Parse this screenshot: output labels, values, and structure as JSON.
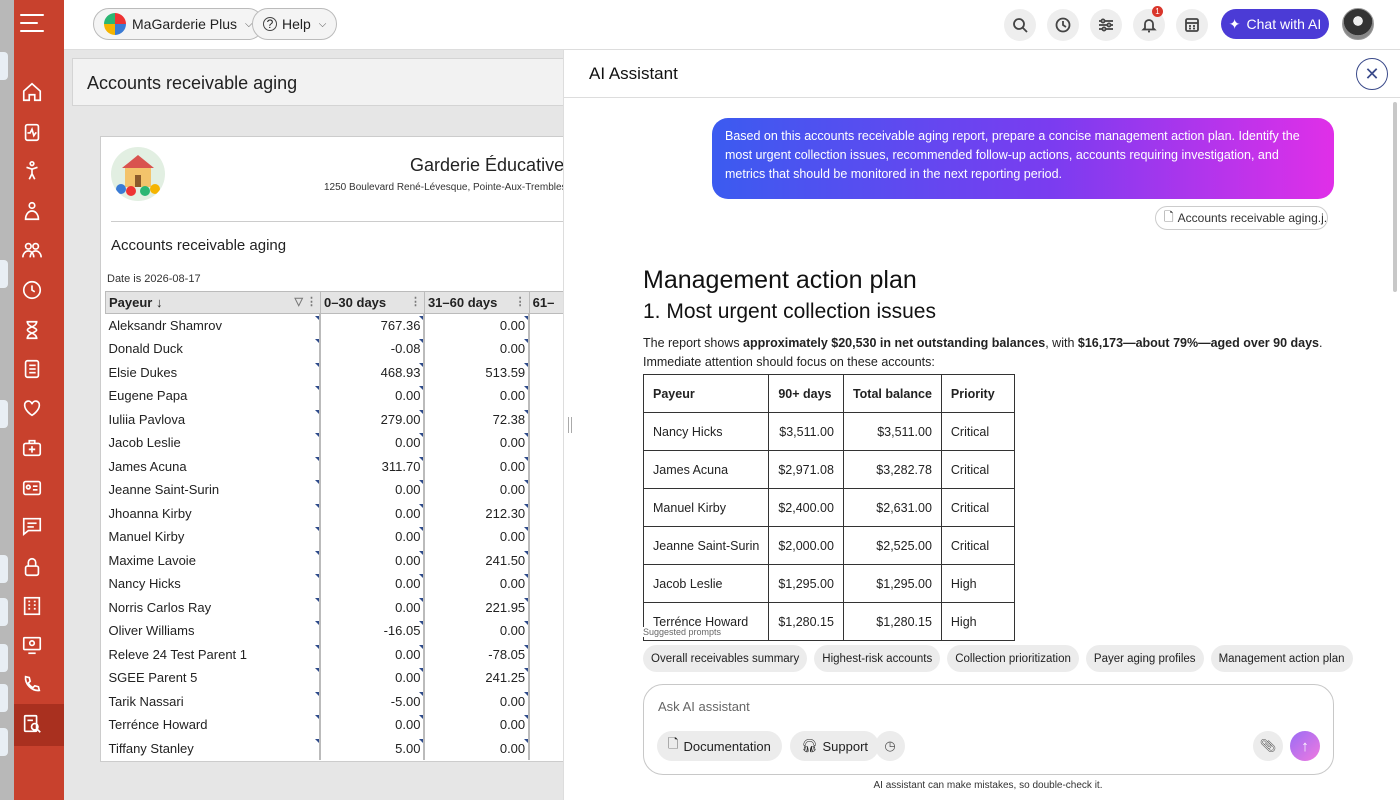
{
  "topbar": {
    "org_selector": "MaGarderie Plus",
    "help": "Help",
    "notifications_count": "1",
    "chat_button": "Chat with AI",
    "icons": [
      "search-icon",
      "history-icon",
      "sliders-icon",
      "bell-icon",
      "calculator-icon"
    ]
  },
  "sidebar": {
    "icons": [
      "home-icon",
      "clipboard-pulse-icon",
      "child-icon",
      "educator-icon",
      "group-icon",
      "clock-icon",
      "hourglass-icon",
      "checklist-icon",
      "heart-icon",
      "first-aid-icon",
      "id-card-icon",
      "message-icon",
      "lock-icon",
      "building-icon",
      "presentation-icon",
      "phone-icon",
      "report-search-icon"
    ]
  },
  "report": {
    "title": "Accounts receivable aging",
    "school_name": "Garderie Éducative",
    "school_address": "1250 Boulevard René-Lévesque, Pointe-Aux-Trembles,",
    "subtitle": "Accounts receivable aging",
    "date": "Date is 2026-08-17",
    "columns": [
      "Payeur ↓",
      "0–30 days",
      "31–60 days",
      "61–"
    ],
    "rows": [
      [
        "Aleksandr Shamrov",
        "767.36",
        "0.00"
      ],
      [
        "Donald Duck",
        "-0.08",
        "0.00"
      ],
      [
        "Elsie Dukes",
        "468.93",
        "513.59"
      ],
      [
        "Eugene Papa",
        "0.00",
        "0.00"
      ],
      [
        "Iuliia Pavlova",
        "279.00",
        "72.38"
      ],
      [
        "Jacob Leslie",
        "0.00",
        "0.00"
      ],
      [
        "James Acuna",
        "311.70",
        "0.00"
      ],
      [
        "Jeanne Saint-Surin",
        "0.00",
        "0.00"
      ],
      [
        "Jhoanna Kirby",
        "0.00",
        "212.30"
      ],
      [
        "Manuel Kirby",
        "0.00",
        "0.00"
      ],
      [
        "Maxime Lavoie",
        "0.00",
        "241.50"
      ],
      [
        "Nancy Hicks",
        "0.00",
        "0.00"
      ],
      [
        "Norris Carlos Ray",
        "0.00",
        "221.95"
      ],
      [
        "Oliver Williams",
        "-16.05",
        "0.00"
      ],
      [
        "Releve 24 Test Parent 1",
        "0.00",
        "-78.05"
      ],
      [
        "SGEE Parent 5",
        "0.00",
        "241.25"
      ],
      [
        "Tarik Nassari",
        "-5.00",
        "0.00"
      ],
      [
        "Terrénce Howard",
        "0.00",
        "0.00"
      ],
      [
        "Tiffany Stanley",
        "5.00",
        "0.00"
      ]
    ]
  },
  "ai": {
    "title": "AI Assistant",
    "user_message": "Based on this accounts receivable aging report, prepare a concise management action plan. Identify the most urgent collection issues, recommended follow-up actions, accounts requiring investigation, and metrics that should be monitored in the next reporting period.",
    "attachment": "Accounts receivable aging.j...",
    "answer_h1": "Management action plan",
    "answer_h2": "1. Most urgent collection issues",
    "answer_p_1": "The report shows ",
    "answer_p_bold1": "approximately $20,530 in net outstanding balances",
    "answer_p_2": ", with ",
    "answer_p_bold2": "$16,173—about 79%—aged over 90 days",
    "answer_p_3": ". Immediate attention should focus on these accounts:",
    "table_headers": [
      "Payeur",
      "90+ days",
      "Total balance",
      "Priority"
    ],
    "table_rows": [
      [
        "Nancy Hicks",
        "$3,511.00",
        "$3,511.00",
        "Critical"
      ],
      [
        "James Acuna",
        "$2,971.08",
        "$3,282.78",
        "Critical"
      ],
      [
        "Manuel Kirby",
        "$2,400.00",
        "$2,631.00",
        "Critical"
      ],
      [
        "Jeanne Saint-Surin",
        "$2,000.00",
        "$2,525.00",
        "Critical"
      ],
      [
        "Jacob Leslie",
        "$1,295.00",
        "$1,295.00",
        "High"
      ],
      [
        "Terrénce Howard",
        "$1,280.15",
        "$1,280.15",
        "High"
      ]
    ],
    "suggested_label": "Suggested prompts",
    "chips": [
      "Overall receivables summary",
      "Highest-risk accounts",
      "Collection prioritization",
      "Payer aging profiles",
      "Management action plan"
    ],
    "input_placeholder": "Ask AI assistant",
    "doc_button": "Documentation",
    "support_button": "Support",
    "disclaimer": "AI assistant can make mistakes, so double-check it."
  }
}
